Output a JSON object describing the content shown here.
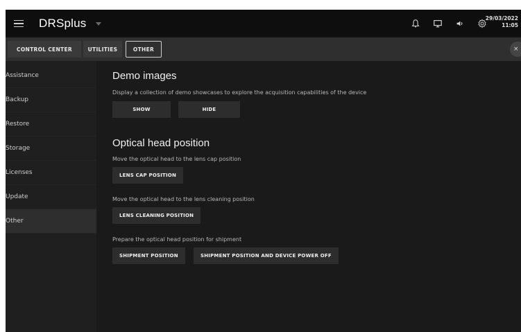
{
  "app": {
    "title": "DRSplus"
  },
  "header": {
    "icons": [
      "menu-icon",
      "caret-down-icon",
      "bell-icon",
      "monitor-icon",
      "speaker-icon",
      "gear-icon"
    ],
    "date": "29/03/2022",
    "time": "11:05"
  },
  "tabs": [
    {
      "label": "CONTROL CENTER"
    },
    {
      "label": "UTILITIES"
    },
    {
      "label": "OTHER",
      "active": true
    }
  ],
  "close_label": "×",
  "sidebar": {
    "items": [
      {
        "label": "Assistance"
      },
      {
        "label": "Backup"
      },
      {
        "label": "Restore"
      },
      {
        "label": "Storage"
      },
      {
        "label": "Licenses"
      },
      {
        "label": "Update"
      },
      {
        "label": "Other",
        "active": true
      }
    ]
  },
  "demo": {
    "title": "Demo images",
    "description": "Display a collection of demo showcases to explore the acquisition capabilities of the device",
    "show_label": "SHOW",
    "hide_label": "HIDE"
  },
  "optical": {
    "title": "Optical head position",
    "lens_cap_desc": "Move the optical head to the lens cap position",
    "lens_cap_label": "LENS CAP POSITION",
    "lens_cleaning_desc": "Move the optical head to the lens cleaning position",
    "lens_cleaning_label": "LENS CLEANING POSITION",
    "shipment_desc": "Prepare the optical head position for shipment",
    "shipment_label": "SHIPMENT POSITION",
    "shipment_poweroff_label": "SHIPMENT POSITION AND DEVICE POWER OFF"
  }
}
